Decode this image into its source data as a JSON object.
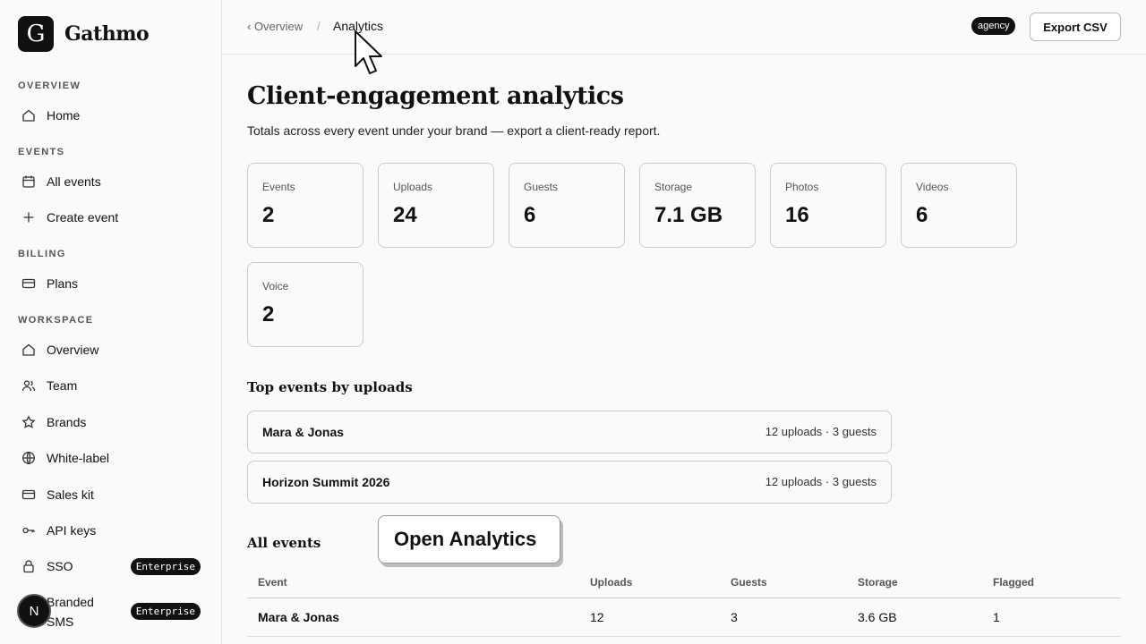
{
  "app": {
    "logo_letter": "G",
    "name": "Gathmo"
  },
  "sidebar": {
    "sections": [
      {
        "label": "OVERVIEW"
      },
      {
        "label": "EVENTS"
      },
      {
        "label": "BILLING"
      },
      {
        "label": "WORKSPACE"
      }
    ],
    "items": [
      {
        "label": "Home",
        "icon": "home-icon"
      },
      {
        "label": "All events",
        "icon": "calendar-icon"
      },
      {
        "label": "Create event",
        "icon": "plus-icon"
      },
      {
        "label": "Plans",
        "icon": "credit-card-icon"
      },
      {
        "label": "Overview",
        "icon": "home-icon"
      },
      {
        "label": "Team",
        "icon": "users-icon"
      },
      {
        "label": "Brands",
        "icon": "star-icon"
      },
      {
        "label": "White-label",
        "icon": "globe-icon"
      },
      {
        "label": "Sales kit",
        "icon": "card-icon"
      },
      {
        "label": "API keys",
        "icon": "key-icon"
      },
      {
        "label": "SSO",
        "icon": "lock-icon",
        "badge": "Enterprise"
      },
      {
        "label": "Branded SMS",
        "icon": "message-icon",
        "badge": "Enterprise"
      }
    ],
    "avatar_initial": "N"
  },
  "header": {
    "back_crumb": "‹ Overview",
    "separator": "/",
    "current_crumb": "Analytics",
    "plan_badge": "agency",
    "export_label": "Export CSV"
  },
  "main": {
    "title": "Client-engagement analytics",
    "subtitle": "Totals across every event under your brand — export a client-ready report.",
    "stats": [
      {
        "label": "Events",
        "value": "2"
      },
      {
        "label": "Uploads",
        "value": "24"
      },
      {
        "label": "Guests",
        "value": "6"
      },
      {
        "label": "Storage",
        "value": "7.1 GB"
      },
      {
        "label": "Photos",
        "value": "16"
      },
      {
        "label": "Videos",
        "value": "6"
      },
      {
        "label": "Voice",
        "value": "2"
      }
    ],
    "top_events_heading": "Top events by uploads",
    "top_events": [
      {
        "name": "Mara & Jonas",
        "meta": "12 uploads · 3 guests"
      },
      {
        "name": "Horizon Summit 2026",
        "meta": "12 uploads · 3 guests"
      }
    ],
    "all_events_heading": "All events",
    "tooltip": "Open Analytics",
    "table": {
      "columns": [
        "Event",
        "Uploads",
        "Guests",
        "Storage",
        "Flagged"
      ],
      "rows": [
        [
          "Mara & Jonas",
          "12",
          "3",
          "3.6 GB",
          "1"
        ]
      ]
    }
  }
}
